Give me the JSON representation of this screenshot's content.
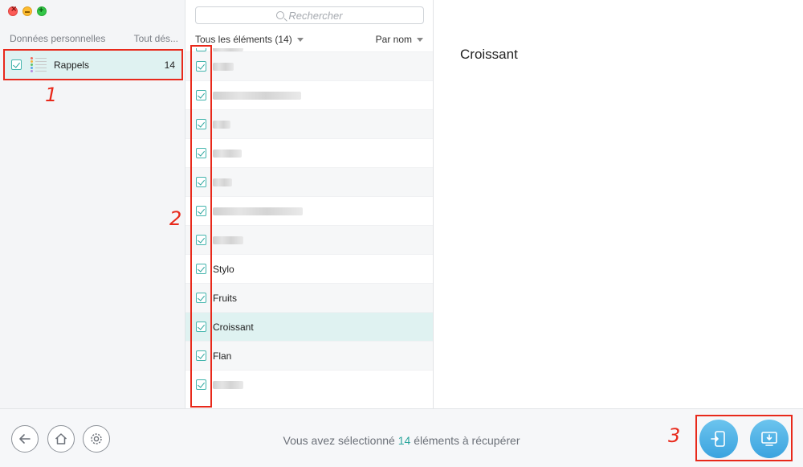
{
  "sidebar": {
    "header_left": "Données personnelles",
    "header_right": "Tout dés...",
    "item": {
      "label": "Rappels",
      "count": "14",
      "checked": true
    }
  },
  "annotations": {
    "one": "1",
    "two": "2",
    "three": "3"
  },
  "list": {
    "search_placeholder": "Rechercher",
    "filter_label": "Tous les éléments (14)",
    "sort_label": "Par nom",
    "rows": [
      {
        "label": "",
        "checked": false,
        "blurred": true
      },
      {
        "label": "",
        "checked": true,
        "blurred": true
      },
      {
        "label": "",
        "checked": true,
        "blurred": true
      },
      {
        "label": "",
        "checked": true,
        "blurred": true
      },
      {
        "label": "",
        "checked": true,
        "blurred": true
      },
      {
        "label": "",
        "checked": true,
        "blurred": true
      },
      {
        "label": "",
        "checked": true,
        "blurred": true
      },
      {
        "label": "",
        "checked": true,
        "blurred": true
      },
      {
        "label": "Stylo",
        "checked": true
      },
      {
        "label": "Fruits",
        "checked": true
      },
      {
        "label": "Croissant",
        "checked": true,
        "selected": true
      },
      {
        "label": "Flan",
        "checked": true
      },
      {
        "label": "",
        "checked": true,
        "blurred": true
      }
    ]
  },
  "detail": {
    "title": "Croissant"
  },
  "status": {
    "prefix": "Vous avez sélectionné",
    "count": "14",
    "suffix": "éléments à récupérer"
  },
  "colors": {
    "accent": "#2aa59c",
    "selection": "#dff2f1",
    "annotation_red": "#e8291b",
    "action_blue": "#3aa3df"
  },
  "icons": {
    "back": "arrow-left-icon",
    "home": "home-icon",
    "settings": "gear-icon",
    "to_device": "phone-import-icon",
    "to_computer": "computer-download-icon"
  }
}
